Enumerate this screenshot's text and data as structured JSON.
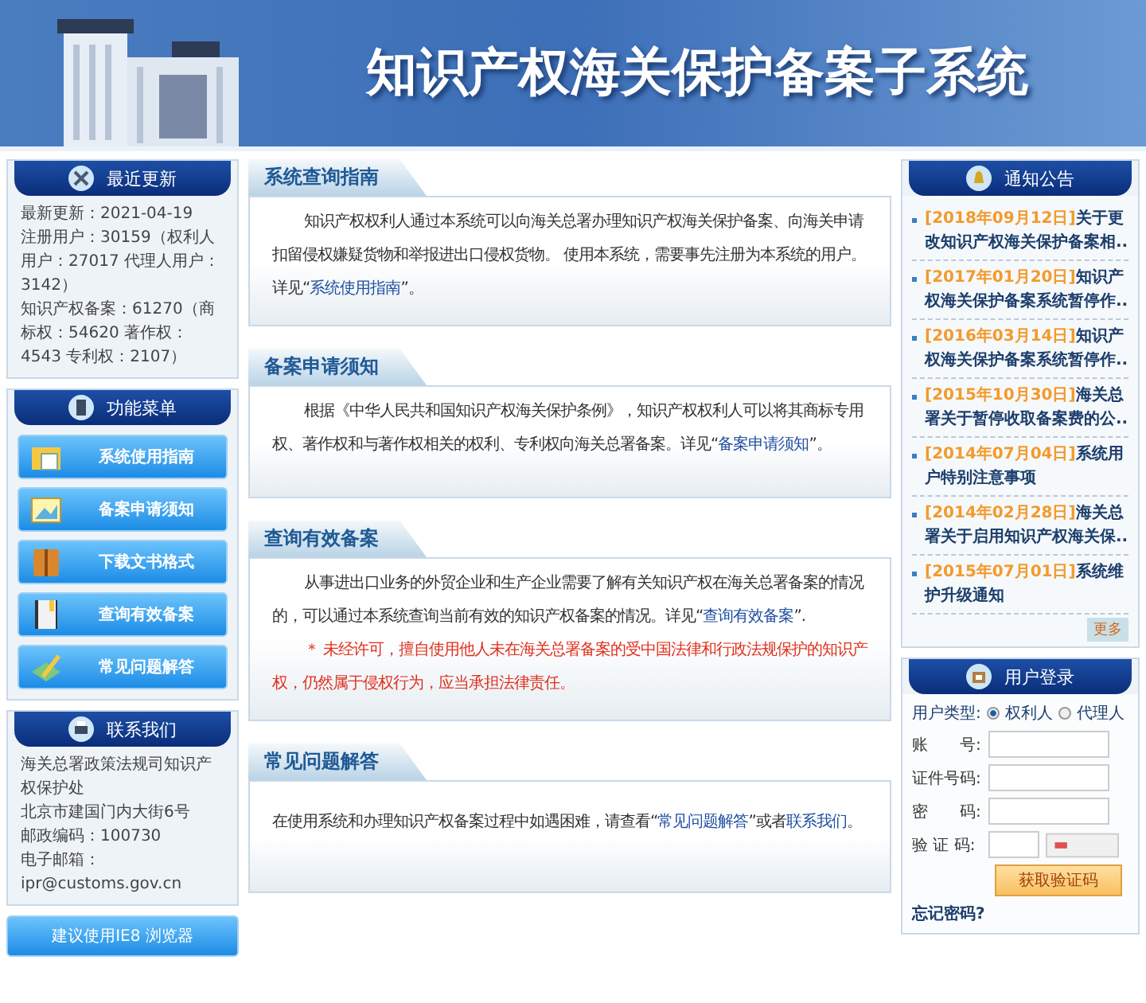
{
  "header": {
    "title": "知识产权海关保护备案子系统"
  },
  "updates": {
    "title": "最近更新",
    "lines": [
      "最新更新：2021-04-19",
      "注册用户：30159（权利人用户：27017 代理人用户：3142）",
      "知识产权备案：61270（商标权：54620 著作权：4543 专利权：2107）"
    ]
  },
  "menu": {
    "title": "功能菜单",
    "items": [
      "系统使用指南",
      "备案申请须知",
      "下载文书格式",
      "查询有效备案",
      "常见问题解答"
    ]
  },
  "contact": {
    "title": "联系我们",
    "lines": [
      "海关总署政策法规司知识产权保护处",
      "北京市建国门内大街6号",
      "邮政编码：100730",
      "电子邮箱：",
      "ipr@customs.gov.cn"
    ]
  },
  "browser_note": "建议使用IE8 浏览器",
  "sections": [
    {
      "title": "系统查询指南",
      "paragraphs": [
        {
          "kind": "normal",
          "segments": [
            {
              "text": "知识产权权利人通过本系统可以向海关总署办理知识产权海关保护备案、向海关申请扣留侵权嫌疑货物和举报进出口侵权货物。 使用本系统，需要事先注册为本系统的用户。详见“",
              "kind": "text"
            },
            {
              "text": "系统使用指南",
              "kind": "link"
            },
            {
              "text": "”。",
              "kind": "text"
            }
          ]
        }
      ]
    },
    {
      "title": "备案申请须知",
      "paragraphs": [
        {
          "kind": "normal",
          "segments": [
            {
              "text": "根据《中华人民共和国知识产权海关保护条例》，知识产权权利人可以将其商标专用权、著作权和与著作权相关的权利、专利权向海关总署备案。详见“",
              "kind": "text"
            },
            {
              "text": "备案申请须知",
              "kind": "link"
            },
            {
              "text": "”。",
              "kind": "text"
            }
          ]
        }
      ]
    },
    {
      "title": "查询有效备案",
      "paragraphs": [
        {
          "kind": "normal",
          "segments": [
            {
              "text": "从事进出口业务的外贸企业和生产企业需要了解有关知识产权在海关总署备案的情况的，可以通过本系统查询当前有效的知识产权备案的情况。详见“",
              "kind": "text"
            },
            {
              "text": "查询有效备案",
              "kind": "link"
            },
            {
              "text": "”.",
              "kind": "text"
            }
          ]
        },
        {
          "kind": "warning",
          "segments": [
            {
              "text": "＊ 未经许可，擅自使用他人未在海关总署备案的受中国法律和行政法规保护的知识产权，仍然属于侵权行为，应当承担法律责任。",
              "kind": "text"
            }
          ]
        }
      ]
    },
    {
      "title": "常见问题解答",
      "paragraphs": [
        {
          "kind": "plain",
          "segments": [
            {
              "text": "在使用系统和办理知识产权备案过程中如遇困难，请查看“",
              "kind": "text"
            },
            {
              "text": "常见问题解答",
              "kind": "link"
            },
            {
              "text": "”或者",
              "kind": "text"
            },
            {
              "text": "联系我们",
              "kind": "link"
            },
            {
              "text": "。",
              "kind": "text"
            }
          ]
        }
      ]
    }
  ],
  "notices": {
    "title": "通知公告",
    "items": [
      {
        "date": "[2018年09月12日]",
        "title": "关于更改知识产权海关保护备案相.."
      },
      {
        "date": "[2017年01月20日]",
        "title": "知识产权海关保护备案系统暂停作.."
      },
      {
        "date": "[2016年03月14日]",
        "title": "知识产权海关保护备案系统暂停作.."
      },
      {
        "date": "[2015年10月30日]",
        "title": "海关总署关于暂停收取备案费的公.."
      },
      {
        "date": "[2014年07月04日]",
        "title": "系统用户特别注意事项"
      },
      {
        "date": "[2014年02月28日]",
        "title": "海关总署关于启用知识产权海关保.."
      },
      {
        "date": "[2015年07月01日]",
        "title": "系统维护升级通知"
      }
    ],
    "more": "更多"
  },
  "login": {
    "title": "用户登录",
    "user_type_label": "用户类型:",
    "user_types": [
      {
        "label": "权利人",
        "selected": true
      },
      {
        "label": "代理人",
        "selected": false
      }
    ],
    "fields": [
      {
        "kind": "text",
        "label": "账　　号:"
      },
      {
        "kind": "text",
        "label": "证件号码:"
      },
      {
        "kind": "password",
        "label": "密　　码:"
      },
      {
        "kind": "captcha",
        "label": "验 证 码:"
      }
    ],
    "get_code_button": "获取验证码",
    "forgot": "忘记密码?"
  }
}
